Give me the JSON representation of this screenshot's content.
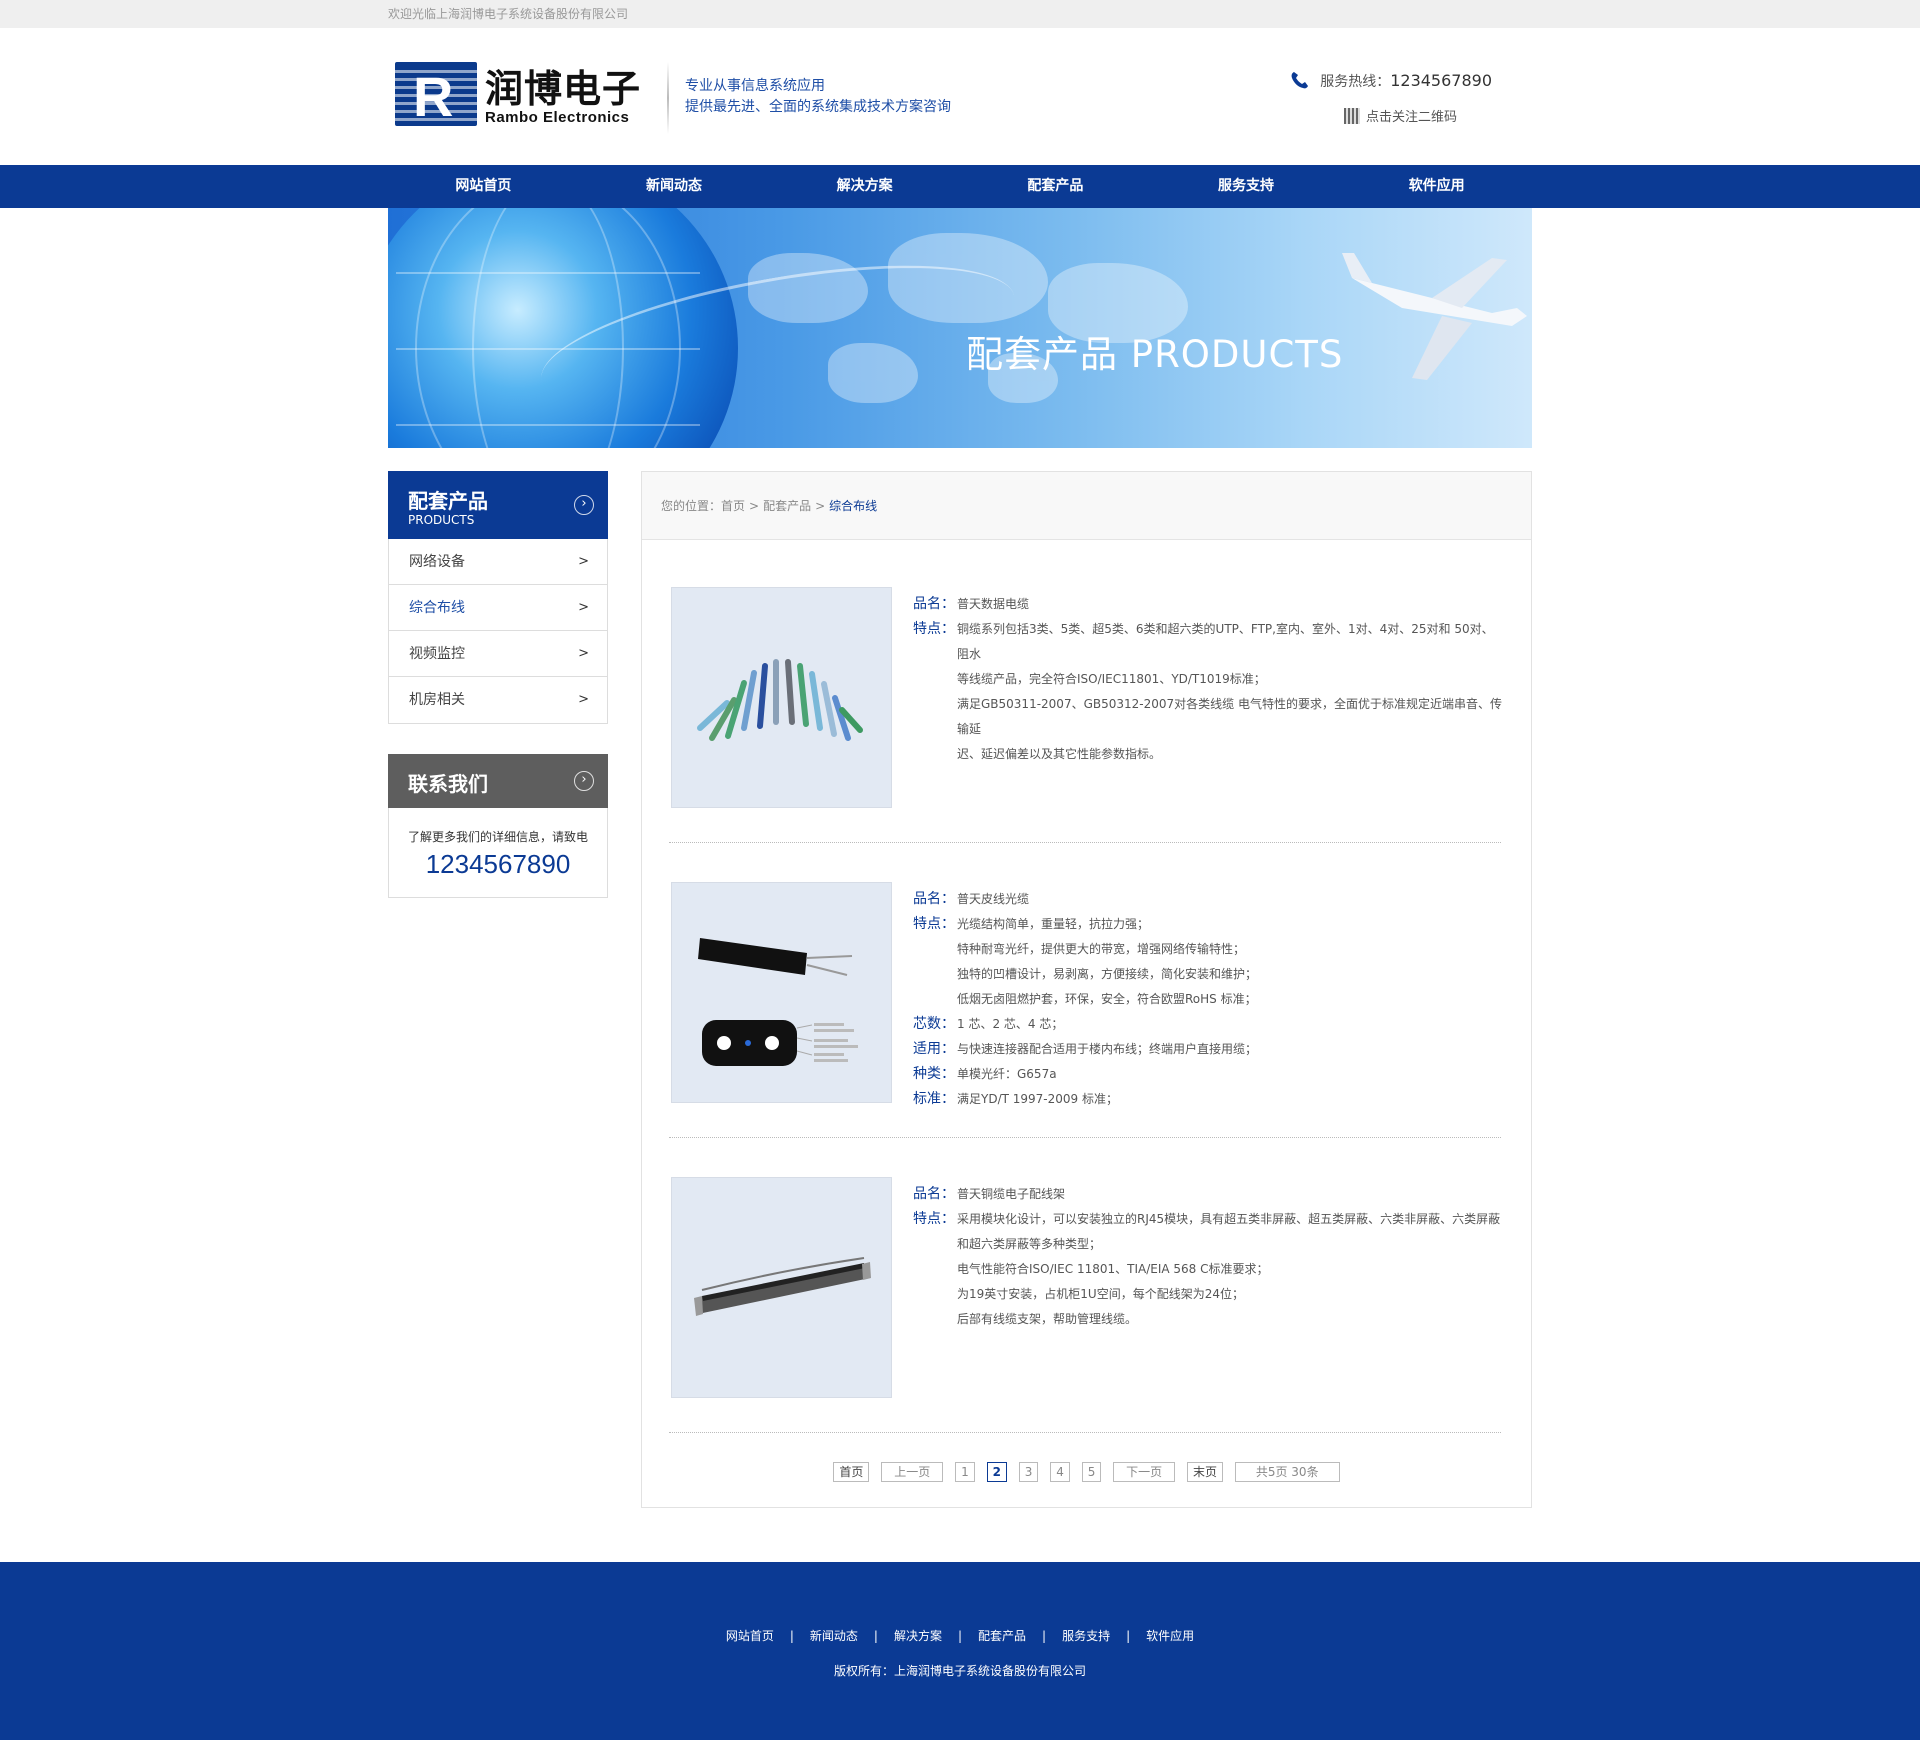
{
  "topbar": {
    "welcome": "欢迎光临上海润博电子系统设备股份有限公司"
  },
  "header": {
    "logo_cn": "润博电子",
    "logo_en": "Rambo Electronics",
    "slogan_line1": "专业从事信息系统应用",
    "slogan_line2": "提供最先进、全面的系统集成技术方案咨询",
    "hotline_label": "服务热线：",
    "hotline_number": "1234567890",
    "qr_label": "点击关注二维码"
  },
  "nav": [
    "网站首页",
    "新闻动态",
    "解决方案",
    "配套产品",
    "服务支持",
    "软件应用"
  ],
  "banner": {
    "title": "配套产品 PRODUCTS"
  },
  "sidebar": {
    "title": "配套产品",
    "subtitle": "PRODUCTS",
    "items": [
      {
        "label": "网络设备",
        "arrow": ">"
      },
      {
        "label": "综合布线",
        "arrow": ">"
      },
      {
        "label": "视频监控",
        "arrow": ">"
      },
      {
        "label": "机房相关",
        "arrow": ">"
      }
    ],
    "contact_title": "联系我们",
    "contact_text": "了解更多我们的详细信息，请致电",
    "contact_tel": "1234567890"
  },
  "breadcrumb": {
    "prefix": "您的位置：",
    "home": "首页",
    "sep": ">",
    "level1": "配套产品",
    "current": "综合布线"
  },
  "products": [
    {
      "name_label": "品名：",
      "name": "普天数据电缆",
      "feat_label": "特点：",
      "feat_lines": [
        "铜缆系列包括3类、5类、超5类、6类和超六类的UTP、FTP,室内、室外、1对、4对、25对和 50对、阻水",
        "等线缆产品，完全符合ISO/IEC11801、YD/T1019标准；",
        "满足GB50311-2007、GB50312-2007对各类线缆 电气特性的要求，全面优于标准规定近端串音、传输延",
        "迟、延迟偏差以及其它性能参数指标。"
      ]
    },
    {
      "name_label": "品名：",
      "name": "普天皮线光缆",
      "feat_label": "特点：",
      "feat_lines": [
        "光缆结构简单，重量轻，抗拉力强；",
        "特种耐弯光纤，提供更大的带宽，增强网络传输特性；",
        "独特的凹槽设计，易剥离，方便接续，简化安装和维护；",
        "低烟无卤阻燃护套，环保，安全，符合欧盟RoHS 标准；"
      ],
      "extra": [
        {
          "label": "芯数：",
          "value": "1 芯、2 芯、4 芯；"
        },
        {
          "label": "适用：",
          "value": "与快速连接器配合适用于楼内布线；终端用户直接用缆；"
        },
        {
          "label": "种类：",
          "value": "单模光纤：G657a"
        },
        {
          "label": "标准：",
          "value": "满足YD/T 1997-2009 标准；"
        }
      ]
    },
    {
      "name_label": "品名：",
      "name": "普天铜缆电子配线架",
      "feat_label": "特点：",
      "feat_lines": [
        "采用模块化设计，可以安装独立的RJ45模块，具有超五类非屏蔽、超五类屏蔽、六类非屏蔽、六类屏蔽",
        "和超六类屏蔽等多种类型；",
        "电气性能符合ISO/IEC 11801、TIA/EIA 568 C标准要求；",
        "为19英寸安装，占机柜1U空间，每个配线架为24位；",
        "后部有线缆支架，帮助管理线缆。"
      ]
    }
  ],
  "pager": {
    "first": "首页",
    "prev": "上一页",
    "pages": [
      "1",
      "2",
      "3",
      "4",
      "5"
    ],
    "current": "2",
    "next": "下一页",
    "last": "末页",
    "summary": "共5页 30条"
  },
  "footer": {
    "nav": [
      "网站首页",
      "新闻动态",
      "解决方案",
      "配套产品",
      "服务支持",
      "软件应用"
    ],
    "separator": "|",
    "copyright": "版权所有：上海润博电子系统设备股份有限公司"
  },
  "colors": {
    "brand": "#0b3a94",
    "footer_bg": "#0b3a94",
    "contact_bg": "#5e5e5e"
  }
}
